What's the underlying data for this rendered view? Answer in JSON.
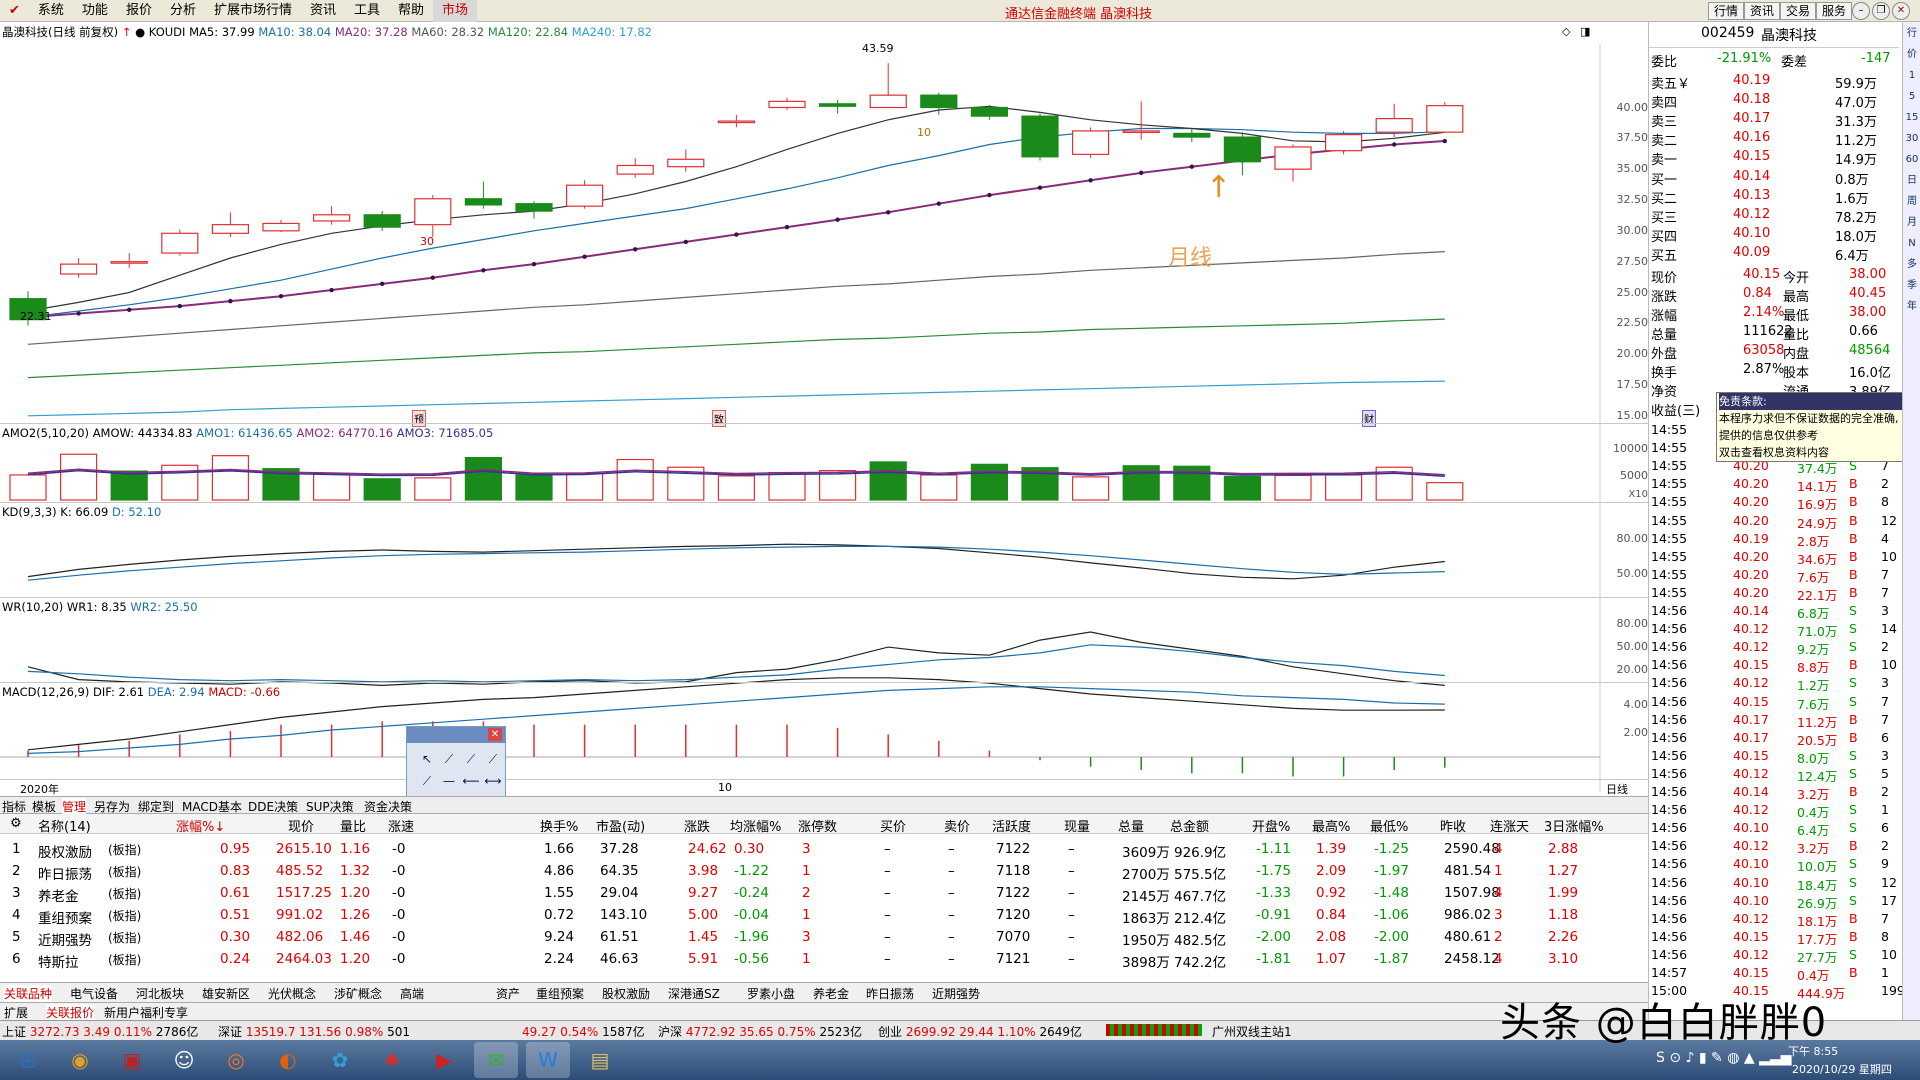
{
  "menubar": {
    "items": [
      "系统",
      "功能",
      "报价",
      "分析",
      "扩展市场行情",
      "资讯",
      "工具",
      "帮助",
      "市场"
    ],
    "title": "通达信金融终端  晶澳科技",
    "right_buttons": [
      "行情",
      "资讯",
      "交易",
      "服务"
    ]
  },
  "chart": {
    "title": "晶澳科技(日线 前复权)",
    "indicator": "KOUDI",
    "ma": [
      {
        "label": "MA5: 37.99",
        "color": "#333333"
      },
      {
        "label": "MA10: 38.04",
        "color": "#1a6faa"
      },
      {
        "label": "MA20: 37.28",
        "color": "#8a2a7a"
      },
      {
        "label": "MA60: 28.32",
        "color": "#555555"
      },
      {
        "label": "MA120: 22.84",
        "color": "#2a8a3a"
      },
      {
        "label": "MA240: 17.82",
        "color": "#30a0d0"
      }
    ],
    "high_label": "43.59",
    "low_label": "22.31",
    "annot_label": "月线",
    "mark10": "10",
    "mark30": "30",
    "yticks": [
      "40.00",
      "37.50",
      "35.00",
      "32.50",
      "30.00",
      "27.50",
      "25.00",
      "22.50",
      "20.00",
      "17.50",
      "15.00"
    ],
    "event_badges": [
      "预",
      "致",
      "财"
    ]
  },
  "chart_data": {
    "type": "candlestick",
    "candles": [
      [
        24.5,
        22.8,
        25.1,
        22.3
      ],
      [
        26.5,
        27.3,
        27.8,
        26.2
      ],
      [
        27.4,
        27.5,
        28.2,
        27.0
      ],
      [
        28.2,
        29.8,
        30.1,
        28.0
      ],
      [
        29.8,
        30.5,
        31.5,
        29.5
      ],
      [
        30.0,
        30.6,
        30.9,
        29.9
      ],
      [
        30.8,
        31.3,
        32.0,
        30.5
      ],
      [
        31.3,
        30.3,
        31.6,
        30.0
      ],
      [
        30.5,
        32.6,
        32.9,
        29.5
      ],
      [
        32.6,
        32.1,
        34.0,
        31.8
      ],
      [
        32.2,
        31.6,
        32.4,
        31.0
      ],
      [
        32.0,
        33.7,
        34.1,
        31.8
      ],
      [
        34.6,
        35.3,
        35.9,
        34.3
      ],
      [
        35.2,
        35.8,
        36.6,
        34.8
      ],
      [
        38.9,
        38.9,
        39.4,
        38.4
      ],
      [
        40.0,
        40.5,
        40.8,
        39.8
      ],
      [
        40.3,
        40.1,
        40.6,
        39.5
      ],
      [
        40.0,
        41.0,
        43.59,
        40.0
      ],
      [
        41.0,
        40.0,
        41.2,
        39.4
      ],
      [
        40.0,
        39.3,
        40.2,
        39.0
      ],
      [
        39.3,
        36.0,
        39.5,
        35.7
      ],
      [
        36.2,
        38.1,
        38.4,
        35.9
      ],
      [
        38.0,
        38.1,
        40.5,
        37.4
      ],
      [
        37.9,
        37.6,
        38.3,
        37.2
      ],
      [
        37.6,
        35.6,
        38.0,
        34.5
      ],
      [
        35.0,
        36.8,
        37.0,
        34.0
      ],
      [
        36.5,
        37.8,
        38.1,
        36.2
      ],
      [
        38.0,
        39.1,
        40.3,
        37.6
      ],
      [
        38.0,
        40.15,
        40.45,
        38.0
      ]
    ],
    "ma5": [
      23.5,
      24.2,
      25.0,
      26.4,
      27.8,
      28.9,
      29.8,
      30.4,
      30.9,
      31.3,
      31.6,
      32.2,
      33.0,
      34.0,
      35.2,
      36.6,
      37.9,
      39.0,
      39.8,
      40.1,
      39.6,
      39.0,
      38.6,
      38.3,
      37.9,
      37.3,
      37.2,
      37.5,
      37.99
    ],
    "ma10": [
      23.0,
      23.5,
      24.0,
      24.6,
      25.3,
      26.0,
      26.9,
      27.8,
      28.6,
      29.3,
      30.0,
      30.6,
      31.2,
      31.8,
      32.6,
      33.4,
      34.3,
      35.3,
      36.1,
      37.0,
      37.6,
      38.0,
      38.3,
      38.3,
      38.2,
      38.0,
      37.9,
      37.9,
      38.04
    ],
    "ma20": [
      23.0,
      23.3,
      23.6,
      23.9,
      24.3,
      24.7,
      25.2,
      25.7,
      26.2,
      26.8,
      27.3,
      27.9,
      28.5,
      29.1,
      29.7,
      30.3,
      30.9,
      31.5,
      32.2,
      32.9,
      33.5,
      34.1,
      34.7,
      35.2,
      35.7,
      36.2,
      36.6,
      37.0,
      37.28
    ],
    "ma60": [
      20.8,
      21.1,
      21.4,
      21.7,
      22.0,
      22.3,
      22.6,
      22.9,
      23.2,
      23.5,
      23.8,
      24.0,
      24.3,
      24.6,
      24.9,
      25.2,
      25.5,
      25.7,
      26.0,
      26.3,
      26.5,
      26.8,
      27.0,
      27.2,
      27.4,
      27.6,
      27.8,
      28.1,
      28.32
    ],
    "ma120": [
      18.1,
      18.3,
      18.5,
      18.7,
      18.9,
      19.1,
      19.3,
      19.5,
      19.7,
      19.9,
      20.1,
      20.2,
      20.4,
      20.6,
      20.8,
      21.0,
      21.2,
      21.3,
      21.5,
      21.7,
      21.8,
      22.0,
      22.1,
      22.2,
      22.3,
      22.4,
      22.5,
      22.7,
      22.84
    ],
    "ma240": [
      15.0,
      15.1,
      15.2,
      15.3,
      15.5,
      15.6,
      15.7,
      15.8,
      15.9,
      16.0,
      16.1,
      16.2,
      16.3,
      16.4,
      16.5,
      16.6,
      16.7,
      16.8,
      16.9,
      17.0,
      17.1,
      17.2,
      17.3,
      17.4,
      17.5,
      17.6,
      17.7,
      17.75,
      17.82
    ],
    "ylim": [
      14.5,
      44.5
    ]
  },
  "amo": {
    "title": "AMO2(5,10,20)",
    "vals": [
      {
        "label": "AMOW: 44334.83",
        "color": "#000000"
      },
      {
        "label": "AMO1: 61436.65",
        "color": "#1a6faa"
      },
      {
        "label": "AMO2: 64770.16",
        "color": "#8a2a7a"
      },
      {
        "label": "AMO3: 71685.05",
        "color": "#333399"
      }
    ],
    "yticks": [
      "10000",
      "5000"
    ],
    "unit": "X10",
    "bars": [
      5200,
      9500,
      6000,
      7200,
      9200,
      6500,
      5500,
      4400,
      4600,
      8800,
      5200,
      5500,
      8400,
      6800,
      5000,
      5700,
      6100,
      7900,
      5200,
      7400,
      6700,
      4800,
      7100,
      7000,
      4900,
      5100,
      5200,
      6800,
      3600
    ],
    "up": [
      true,
      true,
      false,
      true,
      true,
      false,
      true,
      false,
      true,
      false,
      false,
      true,
      true,
      true,
      true,
      true,
      true,
      false,
      true,
      false,
      false,
      true,
      false,
      false,
      false,
      true,
      true,
      true,
      true
    ]
  },
  "kd": {
    "title": "KD(9,3,3)",
    "vals": [
      {
        "label": "K: 66.09",
        "color": "#000000"
      },
      {
        "label": "D: 52.10",
        "color": "#1a6faa"
      }
    ],
    "yticks": [
      "80.00",
      "50.00"
    ],
    "k": [
      45,
      55,
      62,
      68,
      73,
      77,
      80,
      82,
      80,
      79,
      81,
      83,
      85,
      87,
      88,
      90,
      89,
      87,
      84,
      78,
      72,
      64,
      57,
      49,
      44,
      42,
      47,
      58,
      66
    ],
    "d": [
      40,
      47,
      53,
      58,
      63,
      67,
      71,
      74,
      76,
      77,
      78,
      79,
      81,
      83,
      85,
      86,
      87,
      87,
      86,
      83,
      79,
      74,
      68,
      62,
      56,
      51,
      48,
      50,
      52
    ]
  },
  "wr": {
    "title": "WR(10,20)",
    "vals": [
      {
        "label": "WR1: 8.35",
        "color": "#000000"
      },
      {
        "label": "WR2: 25.50",
        "color": "#1a6faa"
      }
    ],
    "yticks": [
      "80.00",
      "50.00",
      "20.00"
    ],
    "w1": [
      40,
      18,
      14,
      12,
      10,
      14,
      12,
      8,
      12,
      10,
      14,
      16,
      12,
      14,
      30,
      36,
      52,
      74,
      64,
      60,
      86,
      100,
      82,
      70,
      58,
      40,
      28,
      16,
      8
    ],
    "w2": [
      32,
      28,
      22,
      18,
      16,
      18,
      16,
      14,
      16,
      14,
      16,
      18,
      16,
      18,
      22,
      26,
      36,
      44,
      52,
      56,
      64,
      78,
      74,
      66,
      56,
      48,
      42,
      32,
      25
    ]
  },
  "macd": {
    "title": "MACD(12,26,9)",
    "vals": [
      {
        "label": "DIF: 2.61",
        "color": "#000000"
      },
      {
        "label": "DEA: 2.94",
        "color": "#1a6faa"
      },
      {
        "label": "MACD: -0.66",
        "color": "#cc0000"
      }
    ],
    "yticks": [
      "4.00",
      "2.00"
    ],
    "dif": [
      0.4,
      0.7,
      1.0,
      1.4,
      1.8,
      2.2,
      2.5,
      2.8,
      3.0,
      3.2,
      3.3,
      3.5,
      3.7,
      3.9,
      4.1,
      4.3,
      4.4,
      4.4,
      4.3,
      4.1,
      3.8,
      3.5,
      3.3,
      3.1,
      2.9,
      2.7,
      2.6,
      2.6,
      2.61
    ],
    "dea": [
      0.2,
      0.3,
      0.5,
      0.7,
      1.0,
      1.2,
      1.5,
      1.7,
      1.9,
      2.1,
      2.3,
      2.5,
      2.7,
      2.9,
      3.1,
      3.3,
      3.5,
      3.7,
      3.8,
      3.9,
      3.9,
      3.8,
      3.7,
      3.6,
      3.4,
      3.3,
      3.2,
      3.0,
      2.94
    ],
    "hist": [
      0.4,
      0.8,
      1.0,
      1.4,
      1.6,
      2.0,
      2.0,
      2.2,
      2.2,
      2.2,
      2.0,
      2.0,
      2.0,
      2.0,
      2.0,
      2.0,
      1.8,
      1.4,
      1.0,
      0.4,
      -0.2,
      -0.6,
      -0.8,
      -1.0,
      -1.0,
      -1.2,
      -1.2,
      -0.8,
      -0.66
    ]
  },
  "xaxis": {
    "left": "2020年",
    "mid": "10",
    "right": "日线"
  },
  "right": {
    "code": "002459",
    "name": "晶澳科技",
    "weibi_label": "委比",
    "weibi": "-21.91%",
    "weicha_label": "委差",
    "weicha": "-147",
    "asks": [
      {
        "l": "卖五￥",
        "p": "40.19",
        "v": "59.9万"
      },
      {
        "l": "卖四",
        "p": "40.18",
        "v": "47.0万"
      },
      {
        "l": "卖三",
        "p": "40.17",
        "v": "31.3万"
      },
      {
        "l": "卖二",
        "p": "40.16",
        "v": "11.2万"
      },
      {
        "l": "卖一",
        "p": "40.15",
        "v": "14.9万"
      }
    ],
    "bids": [
      {
        "l": "买一",
        "p": "40.14",
        "v": "0.8万"
      },
      {
        "l": "买二",
        "p": "40.13",
        "v": "1.6万"
      },
      {
        "l": "买三",
        "p": "40.12",
        "v": "78.2万"
      },
      {
        "l": "买四",
        "p": "40.10",
        "v": "18.0万"
      },
      {
        "l": "买五",
        "p": "40.09",
        "v": "6.4万"
      }
    ],
    "stats": [
      {
        "l1": "现价",
        "v1": "40.15",
        "l2": "今开",
        "v2": "38.00"
      },
      {
        "l1": "涨跌",
        "v1": "0.84",
        "l2": "最高",
        "v2": "40.45"
      },
      {
        "l1": "涨幅",
        "v1": "2.14%",
        "l2": "最低",
        "v2": "38.00"
      },
      {
        "l1": "总量",
        "v1": "111622",
        "l2": "量比",
        "v2": "0.66"
      },
      {
        "l1": "外盘",
        "v1": "63058",
        "l2": "内盘",
        "v2": "48564"
      },
      {
        "l1": "换手",
        "v1": "2.87%",
        "l2": "股本",
        "v2": "16.0亿"
      },
      {
        "l1": "净资",
        "v1": "",
        "l2": "流通",
        "v2": "3.89亿"
      },
      {
        "l1": "收益(三)",
        "v1": "",
        "l2": "",
        "v2": ""
      }
    ],
    "tooltip": {
      "title": "免责条款:",
      "l1": "本程序力求但不保证数据的完全准确,",
      "l2": "提供的信息仅供参考",
      "l3": "双击查看权息资料内容"
    },
    "ticks": [
      [
        "14:55",
        "",
        "",
        "",
        ""
      ],
      [
        "14:55",
        "",
        "",
        "",
        ""
      ],
      [
        "14:55",
        "40.20",
        "37.4万",
        "S",
        "7"
      ],
      [
        "14:55",
        "40.20",
        "14.1万",
        "B",
        "2"
      ],
      [
        "14:55",
        "40.20",
        "16.9万",
        "B",
        "8"
      ],
      [
        "14:55",
        "40.20",
        "24.9万",
        "B",
        "12"
      ],
      [
        "14:55",
        "40.19",
        "2.8万",
        "B",
        "4"
      ],
      [
        "14:55",
        "40.20",
        "34.6万",
        "B",
        "10"
      ],
      [
        "14:55",
        "40.20",
        "7.6万",
        "B",
        "7"
      ],
      [
        "14:55",
        "40.20",
        "22.1万",
        "B",
        "7"
      ],
      [
        "14:56",
        "40.14",
        "6.8万",
        "S",
        "3"
      ],
      [
        "14:56",
        "40.12",
        "71.0万",
        "S",
        "14"
      ],
      [
        "14:56",
        "40.12",
        "9.2万",
        "S",
        "2"
      ],
      [
        "14:56",
        "40.15",
        "8.8万",
        "B",
        "10"
      ],
      [
        "14:56",
        "40.12",
        "1.2万",
        "S",
        "3"
      ],
      [
        "14:56",
        "40.15",
        "7.6万",
        "S",
        "7"
      ],
      [
        "14:56",
        "40.17",
        "11.2万",
        "B",
        "7"
      ],
      [
        "14:56",
        "40.17",
        "20.5万",
        "B",
        "6"
      ],
      [
        "14:56",
        "40.15",
        "8.0万",
        "S",
        "3"
      ],
      [
        "14:56",
        "40.12",
        "12.4万",
        "S",
        "5"
      ],
      [
        "14:56",
        "40.14",
        "3.2万",
        "B",
        "2"
      ],
      [
        "14:56",
        "40.12",
        "0.4万",
        "S",
        "1"
      ],
      [
        "14:56",
        "40.10",
        "6.4万",
        "S",
        "6"
      ],
      [
        "14:56",
        "40.12",
        "3.2万",
        "B",
        "2"
      ],
      [
        "14:56",
        "40.10",
        "10.0万",
        "S",
        "9"
      ],
      [
        "14:56",
        "40.10",
        "18.4万",
        "S",
        "12"
      ],
      [
        "14:56",
        "40.10",
        "26.9万",
        "S",
        "17"
      ],
      [
        "14:56",
        "40.12",
        "18.1万",
        "B",
        "7"
      ],
      [
        "14:56",
        "40.15",
        "17.7万",
        "B",
        "8"
      ],
      [
        "14:56",
        "40.12",
        "27.7万",
        "S",
        "10"
      ],
      [
        "14:57",
        "40.15",
        "0.4万",
        "B",
        "1"
      ],
      [
        "15:00",
        "40.15",
        "444.9万",
        "",
        "199"
      ]
    ]
  },
  "sidebar": [
    "行",
    "价",
    "1",
    "5",
    "15",
    "30",
    "60",
    "日",
    "周",
    "月",
    "N",
    "多",
    "季",
    "年"
  ],
  "tabs1": [
    "指标",
    "模板",
    "管理",
    "另存为",
    "绑定到",
    "MACD基本",
    "DDE决策",
    "SUP决策",
    "资金决策"
  ],
  "table": {
    "headers_left": [
      "名称(14)",
      "涨幅%↓",
      "现价",
      "量比",
      "涨速"
    ],
    "headers_right": [
      "换手%",
      "市盈(动)",
      "涨跌",
      "均涨幅%",
      "涨停数",
      "买价",
      "卖价",
      "活跃度",
      "现量",
      "总量",
      "总金额",
      "开盘%",
      "最高%",
      "最低%",
      "昨收",
      "连涨天",
      "3日涨幅%"
    ],
    "rows": [
      {
        "n": "1",
        "name": "股权激励",
        "tag": "(板指)",
        "chg": "0.95",
        "price": "2615.10",
        "lb": "1.16",
        "zs": "-0",
        "r": [
          "1.66",
          "37.28",
          "24.62",
          "0.30",
          "3",
          "–",
          "–",
          "7122",
          "–",
          "3609万",
          "926.9亿",
          "-1.11",
          "1.39",
          "-1.25",
          "2590.48",
          "4",
          "2.88"
        ]
      },
      {
        "n": "2",
        "name": "昨日振荡",
        "tag": "(板指)",
        "chg": "0.83",
        "price": "485.52",
        "lb": "1.32",
        "zs": "-0",
        "r": [
          "4.86",
          "64.35",
          "3.98",
          "-1.22",
          "1",
          "–",
          "–",
          "7118",
          "–",
          "2700万",
          "575.5亿",
          "-1.75",
          "2.09",
          "-1.97",
          "481.54",
          "1",
          "1.27"
        ]
      },
      {
        "n": "3",
        "name": "养老金",
        "tag": "(板指)",
        "chg": "0.61",
        "price": "1517.25",
        "lb": "1.20",
        "zs": "-0",
        "r": [
          "1.55",
          "29.04",
          "9.27",
          "-0.24",
          "2",
          "–",
          "–",
          "7122",
          "–",
          "2145万",
          "467.7亿",
          "-1.33",
          "0.92",
          "-1.48",
          "1507.98",
          "4",
          "1.99"
        ]
      },
      {
        "n": "4",
        "name": "重组预案",
        "tag": "(板指)",
        "chg": "0.51",
        "price": "991.02",
        "lb": "1.26",
        "zs": "-0",
        "r": [
          "0.72",
          "143.10",
          "5.00",
          "-0.04",
          "1",
          "–",
          "–",
          "7120",
          "–",
          "1863万",
          "212.4亿",
          "-0.91",
          "0.84",
          "-1.06",
          "986.02",
          "3",
          "1.18"
        ]
      },
      {
        "n": "5",
        "name": "近期强势",
        "tag": "(板指)",
        "chg": "0.30",
        "price": "482.06",
        "lb": "1.46",
        "zs": "-0",
        "r": [
          "9.24",
          "61.51",
          "1.45",
          "-1.96",
          "3",
          "–",
          "–",
          "7070",
          "–",
          "1950万",
          "482.5亿",
          "-2.00",
          "2.08",
          "-2.00",
          "480.61",
          "2",
          "2.26"
        ]
      },
      {
        "n": "6",
        "name": "特斯拉",
        "tag": "(板指)",
        "chg": "0.24",
        "price": "2464.03",
        "lb": "1.20",
        "zs": "-0",
        "r": [
          "2.24",
          "46.63",
          "5.91",
          "-0.56",
          "1",
          "–",
          "–",
          "7121",
          "–",
          "3898万",
          "742.2亿",
          "-1.81",
          "1.07",
          "-1.87",
          "2458.12",
          "4",
          "3.10"
        ]
      }
    ]
  },
  "tabs2": [
    "关联品种",
    "电气设备",
    "河北板块",
    "雄安新区",
    "光伏概念",
    "涉矿概念",
    "高端",
    "",
    "",
    "",
    "",
    "资产",
    "重组预案",
    "股权激励",
    "深港通SZ",
    "罗素小盘",
    "养老金",
    "昨日振荡",
    "近期强势"
  ],
  "tabs3": [
    "扩展",
    "关联报价",
    "新用户福利专享"
  ],
  "index": {
    "sh_label": "上证",
    "sh": "3272.73",
    "sh_c": "3.49",
    "sh_p": "0.11%",
    "sh_v": "2786亿",
    "sz_label": "深证",
    "sz": "13519.7",
    "sz_c": "131.56",
    "sz_p": "0.98%",
    "sz_v": "501",
    "m1": "49.27",
    "m2": "0.54%",
    "m3": "1587亿",
    "hs_label": "沪深",
    "hs": "4772.92",
    "hs_c": "35.65",
    "hs_p": "0.75%",
    "hs_v": "2523亿",
    "cy_label": "创业",
    "cy": "2699.92",
    "cy_c": "29.44",
    "cy_p": "1.10%",
    "cy_v": "2649亿",
    "server": "广州双线主站1"
  },
  "taskbar": {
    "time": "下午 8:55",
    "date": "2020/10/29 星期四",
    "apps": [
      "⊞",
      "◉",
      "▣",
      "☺",
      "◎",
      "◐",
      "✿",
      "♠",
      "▶",
      "✉",
      "W",
      "▤"
    ]
  },
  "watermark": "头条 @白白胖胖0"
}
